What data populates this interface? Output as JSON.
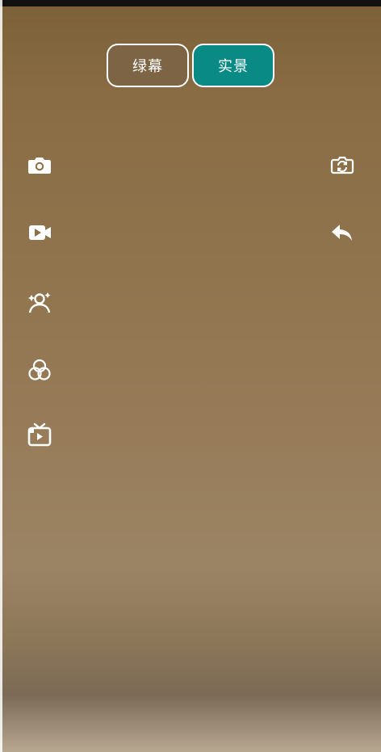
{
  "modes": {
    "greenscreen_label": "绿幕",
    "realscene_label": "实景",
    "selected": "实景"
  },
  "colors": {
    "selected_mode_bg": "#098a84",
    "unselected_mode_bg": "#7c6444",
    "icon_color": "#ffffff"
  },
  "icons": {
    "left_toolbar": [
      "camera-icon",
      "video-camera-icon",
      "beauty-person-sparkle-icon",
      "filter-circles-icon",
      "tv-video-icon"
    ],
    "right_toolbar": [
      "switch-camera-icon",
      "back-reply-icon"
    ]
  }
}
